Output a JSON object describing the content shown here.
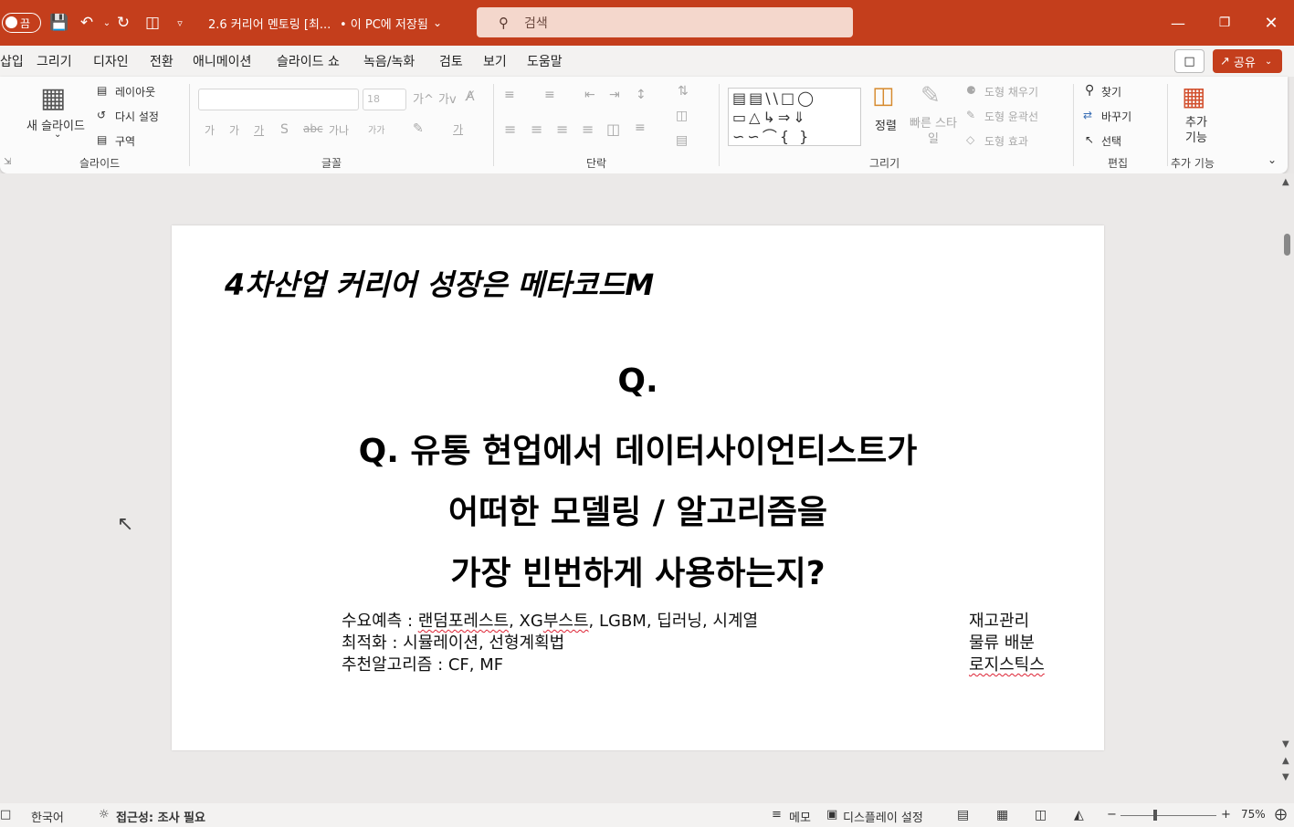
{
  "titlebar": {
    "autosave_label": "끔",
    "doc_title": "2.6 커리어 멘토링 [최...",
    "save_status": "• 이 PC에 저장됨",
    "search_placeholder": "검색"
  },
  "menu": {
    "tabs": [
      "삽입",
      "그리기",
      "디자인",
      "전환",
      "애니메이션",
      "슬라이드 쇼",
      "녹음/녹화",
      "검토",
      "보기",
      "도움말"
    ],
    "share_label": "공유"
  },
  "ribbon": {
    "slides": {
      "new_slide": "새 슬라이드",
      "layout": "레이아웃",
      "reset": "다시 설정",
      "section": "구역",
      "group_label": "슬라이드"
    },
    "font": {
      "size_value": "18",
      "group_label": "글꼴"
    },
    "paragraph": {
      "group_label": "단락"
    },
    "drawing": {
      "arrange": "정렬",
      "quick_styles": "빠른 스타일",
      "shape_fill": "도형 채우기",
      "shape_outline": "도형 윤곽선",
      "shape_effects": "도형 효과",
      "group_label": "그리기"
    },
    "editing": {
      "find": "찾기",
      "replace": "바꾸기",
      "select": "선택",
      "group_label": "편집"
    },
    "addins": {
      "label": "추가 기능",
      "group_label": "추가 기능"
    }
  },
  "slide": {
    "title": "4차산업 커리어 성장은 메타코드M",
    "q_lines": [
      "Q.",
      "Q. 유통 현업에서 데이터사이언티스트가",
      "어떠한 모델링 / 알고리즘을",
      "가장 빈번하게 사용하는지?"
    ],
    "left_lines": {
      "l1_prefix": "수요예측 : ",
      "l1_a": "랜덤포레스트",
      "l1_b": ", XG",
      "l1_c": "부스트",
      "l1_d": ", LGBM, 딥러닝, 시계열",
      "l2": "최적화 : 시뮬레이션, 선형계획법",
      "l3": "추천알고리즘 : CF, MF"
    },
    "right_lines": [
      "재고관리",
      "물류 배분",
      "로지스틱스"
    ]
  },
  "statusbar": {
    "language": "한국어",
    "accessibility": "접근성: 조사 필요",
    "notes": "메모",
    "display_settings": "디스플레이 설정",
    "zoom": "75%"
  }
}
